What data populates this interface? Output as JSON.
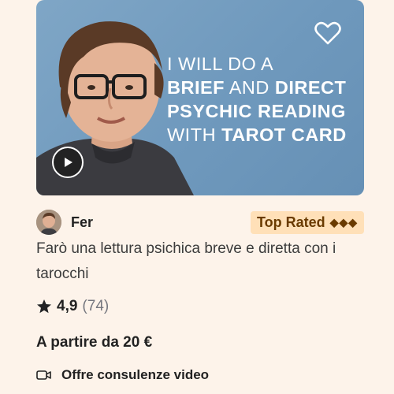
{
  "thumbnail": {
    "lines": [
      {
        "normal": "I WILL DO A",
        "bold": ""
      },
      {
        "normal": "",
        "bold": "BRIEF",
        "normal2": " AND ",
        "bold2": "DIRECT"
      },
      {
        "normal": "",
        "bold": "PSYCHIC READING"
      },
      {
        "normal": "WITH ",
        "bold": "TAROT CARD"
      }
    ],
    "bg_color": "#7fa6c6"
  },
  "seller": {
    "name": "Fer",
    "badge_label": "Top Rated",
    "badge_diamonds": "◆◆◆"
  },
  "gig": {
    "title": "Farò una lettura psichica breve e diretta con i tarocchi",
    "rating": "4,9",
    "review_count": "(74)",
    "price_label": "A partire da 20 €",
    "video_label": "Offre consulenze video"
  },
  "icons": {
    "heart": "heart-icon",
    "play": "play-icon",
    "star": "star-icon",
    "video": "video-camera-icon"
  }
}
